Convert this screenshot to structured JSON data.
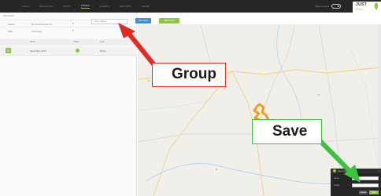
{
  "nav": {
    "items": [
      "DASH",
      "ALGO DATA",
      "PRINT",
      "ZONES",
      "ALERTS",
      "REPORTS",
      "ADMIN"
    ],
    "active_index": 3
  },
  "header": {
    "toggle_label": "Show Groups",
    "logo_top": "JUST",
    "logo_bottom": "TRAC"
  },
  "left_panel": {
    "title": "View Zones",
    "filters": [
      {
        "label": "Search",
        "value": "My Zones/Groups (1)",
        "icon": "chevron-down-icon"
      },
      {
        "label": "Filter",
        "value": "All Groups",
        "icon": "chevron-down-icon"
      }
    ],
    "columns": [
      "Name",
      "Status",
      "Type"
    ],
    "rows": [
      {
        "name": "September 2017",
        "status_color": "#8cc63e",
        "type": "Route"
      }
    ]
  },
  "toolbar": {
    "group_select_value": "Group Name",
    "blue_button": "New Zone",
    "green_button": "Add Group"
  },
  "annotations": {
    "group_label": "Group",
    "save_label": "Save",
    "group_color": "#d9322b",
    "save_color": "#3ec13e"
  },
  "save_popup": {
    "title": "Save Zone",
    "name_label": "Name",
    "name_value": "Zone...",
    "group_label": "Group",
    "cancel_label": "Cancel",
    "save_label": "Save"
  },
  "colors": {
    "nav_bg": "#262626",
    "accent": "#8cc63e",
    "primary": "#3d8fd6",
    "route": "#f39a1f"
  }
}
